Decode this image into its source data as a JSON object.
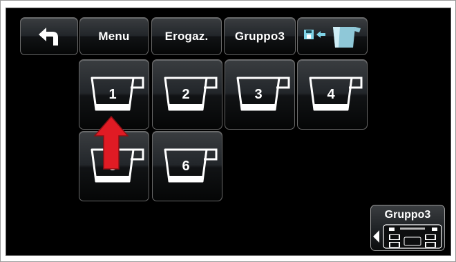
{
  "toolbar": {
    "back_icon": "back-arrow-icon",
    "menu_label": "Menu",
    "erogaz_label": "Erogaz.",
    "group_label": "Gruppo3",
    "save_icon": "save-to-jug-icon"
  },
  "cups": [
    {
      "number": "1"
    },
    {
      "number": "2"
    },
    {
      "number": "3"
    },
    {
      "number": "4"
    },
    {
      "number": "5"
    },
    {
      "number": "6"
    }
  ],
  "overlay": {
    "icon": "red-up-arrow-icon",
    "color": "#e01b24"
  },
  "corner": {
    "label": "Gruppo3",
    "icon": "group-panel-icon"
  },
  "colors": {
    "screen_bg": "#000000",
    "button_text": "#ffffff",
    "accent_blue": "#7fd3e6"
  }
}
